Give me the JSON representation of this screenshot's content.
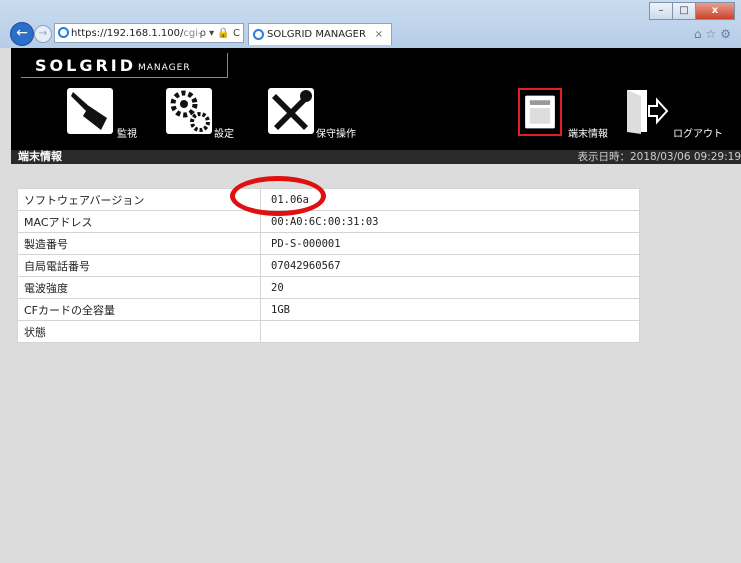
{
  "browser": {
    "url_main": "https://192.168.1.100/",
    "url_rest": "cgi-",
    "url_controls": "ρ ▾ 🔒 C",
    "tab_title": "SOLGRID MANAGER",
    "tab_close": "×",
    "win_min": "–",
    "win_max": "□",
    "win_close": "x",
    "right_icons": "⌂☆⚙"
  },
  "app": {
    "logo_main": "SOLGRID",
    "logo_sub": "MANAGER",
    "menu": [
      {
        "label": "監視",
        "icon": "broom-icon"
      },
      {
        "label": "設定",
        "icon": "gears-icon"
      },
      {
        "label": "保守操作",
        "icon": "tools-icon"
      },
      {
        "label": "端末情報",
        "icon": "terminal-device-icon"
      },
      {
        "label": "ログアウト",
        "icon": "logout-door-icon"
      }
    ],
    "selected_menu": "端末情報"
  },
  "titlebar": {
    "title": "端末情報",
    "datetime": "表示日時：2018/03/06 09:29:19"
  },
  "info_table": [
    {
      "key": "ソフトウェアバージョン",
      "value": "01.06a"
    },
    {
      "key": "MACアドレス",
      "value": "00:A0:6C:00:31:03"
    },
    {
      "key": "製造番号",
      "value": "PD-S-000001"
    },
    {
      "key": "自局電話番号",
      "value": "07042960567"
    },
    {
      "key": "電波強度",
      "value": "20"
    },
    {
      "key": "CFカードの全容量",
      "value": "1GB"
    },
    {
      "key": "状態",
      "value": ""
    }
  ],
  "colors": {
    "highlight_circle": "#e01010",
    "selected_border": "#e02020",
    "header_bg": "#000000"
  }
}
